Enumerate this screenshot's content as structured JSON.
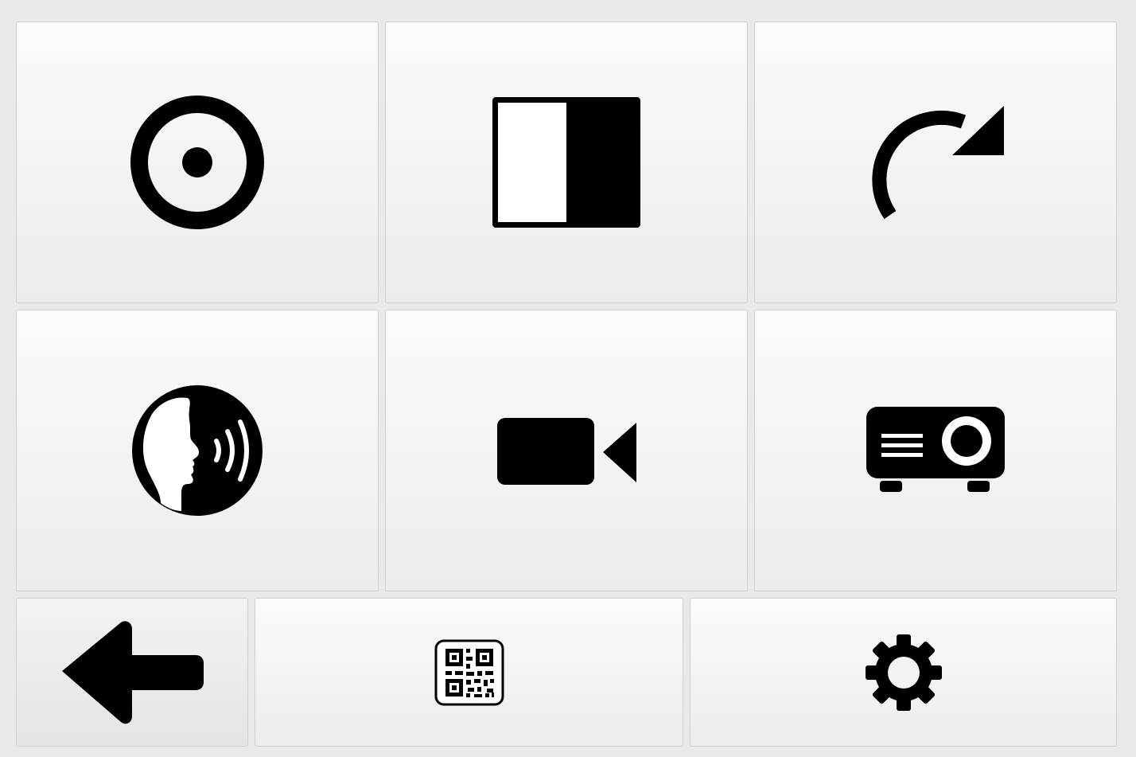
{
  "colors": {
    "icon": "#000000",
    "tile_top": "#fbfbfb",
    "tile_bottom": "#ececec",
    "background": "#e9e9e9"
  },
  "tiles": [
    {
      "row": 1,
      "col": 1,
      "icon": "target-icon"
    },
    {
      "row": 1,
      "col": 2,
      "icon": "contrast-icon"
    },
    {
      "row": 1,
      "col": 3,
      "icon": "rotate-icon"
    },
    {
      "row": 2,
      "col": 1,
      "icon": "speak-icon"
    },
    {
      "row": 2,
      "col": 2,
      "icon": "video-camera-icon"
    },
    {
      "row": 2,
      "col": 3,
      "icon": "projector-icon"
    },
    {
      "row": 3,
      "col": 1,
      "icon": "arrow-left-icon"
    },
    {
      "row": 3,
      "col": 2,
      "icon": "qr-code-icon"
    },
    {
      "row": 3,
      "col": 3,
      "icon": "gear-icon"
    }
  ]
}
